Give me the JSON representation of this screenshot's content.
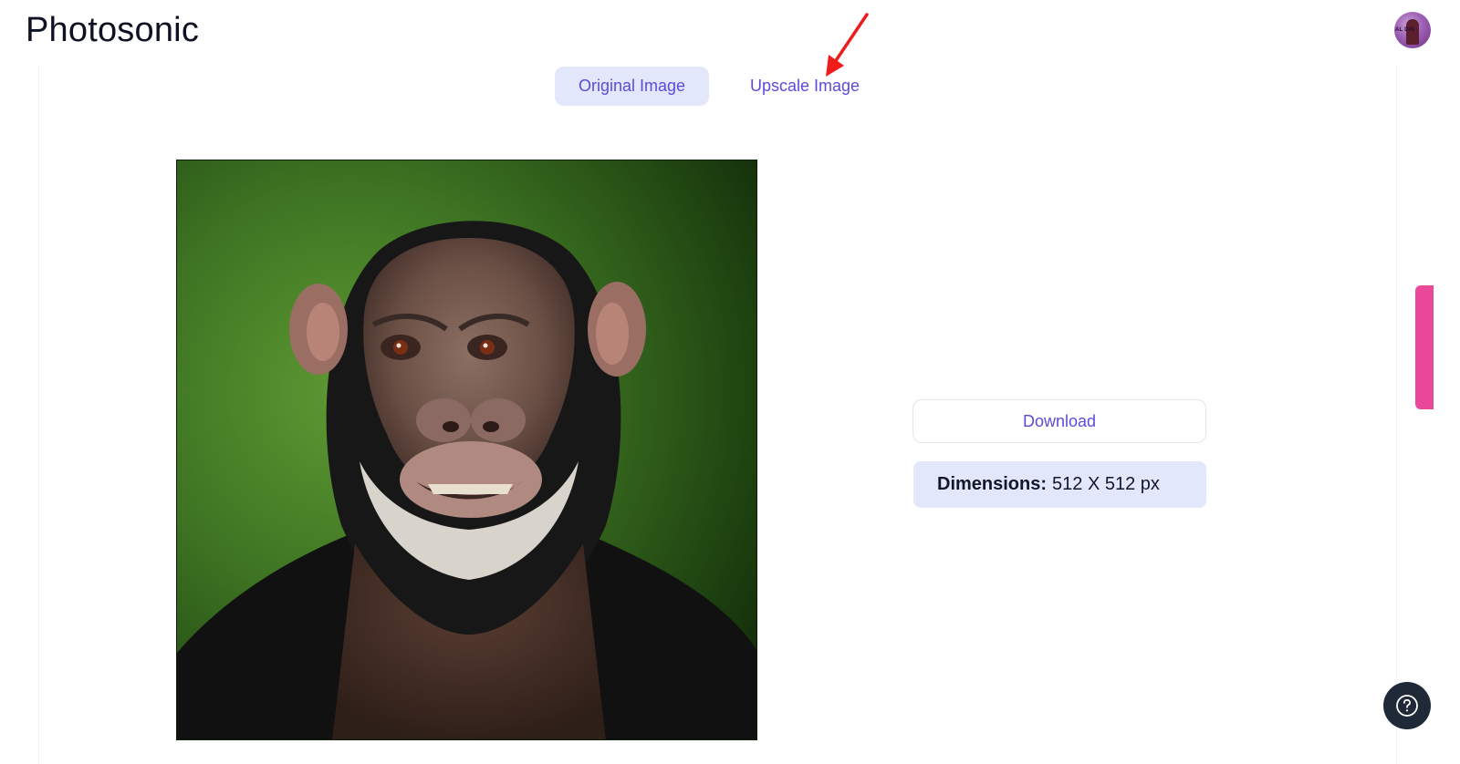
{
  "header": {
    "app_title": "Photosonic",
    "avatar": {
      "icon": "user-avatar",
      "initials": "AL DIN"
    }
  },
  "tabs": [
    {
      "label": "Original Image",
      "active": true
    },
    {
      "label": "Upscale Image",
      "active": false
    }
  ],
  "annotation": {
    "icon": "red-arrow-icon",
    "color": "#ef1c1c"
  },
  "image_preview": {
    "subject": "chimpanzee portrait"
  },
  "actions": {
    "download_label": "Download"
  },
  "info": {
    "dimensions_key": "Dimensions:",
    "dimensions_value": "512 X 512 px"
  },
  "floating": {
    "help_icon": "question-circle-icon",
    "side_tab_color": "#ec4899"
  },
  "colors": {
    "accent": "#5b4bdb",
    "tab_active_bg": "#e3e7fb",
    "help_bg": "#1f2937"
  }
}
